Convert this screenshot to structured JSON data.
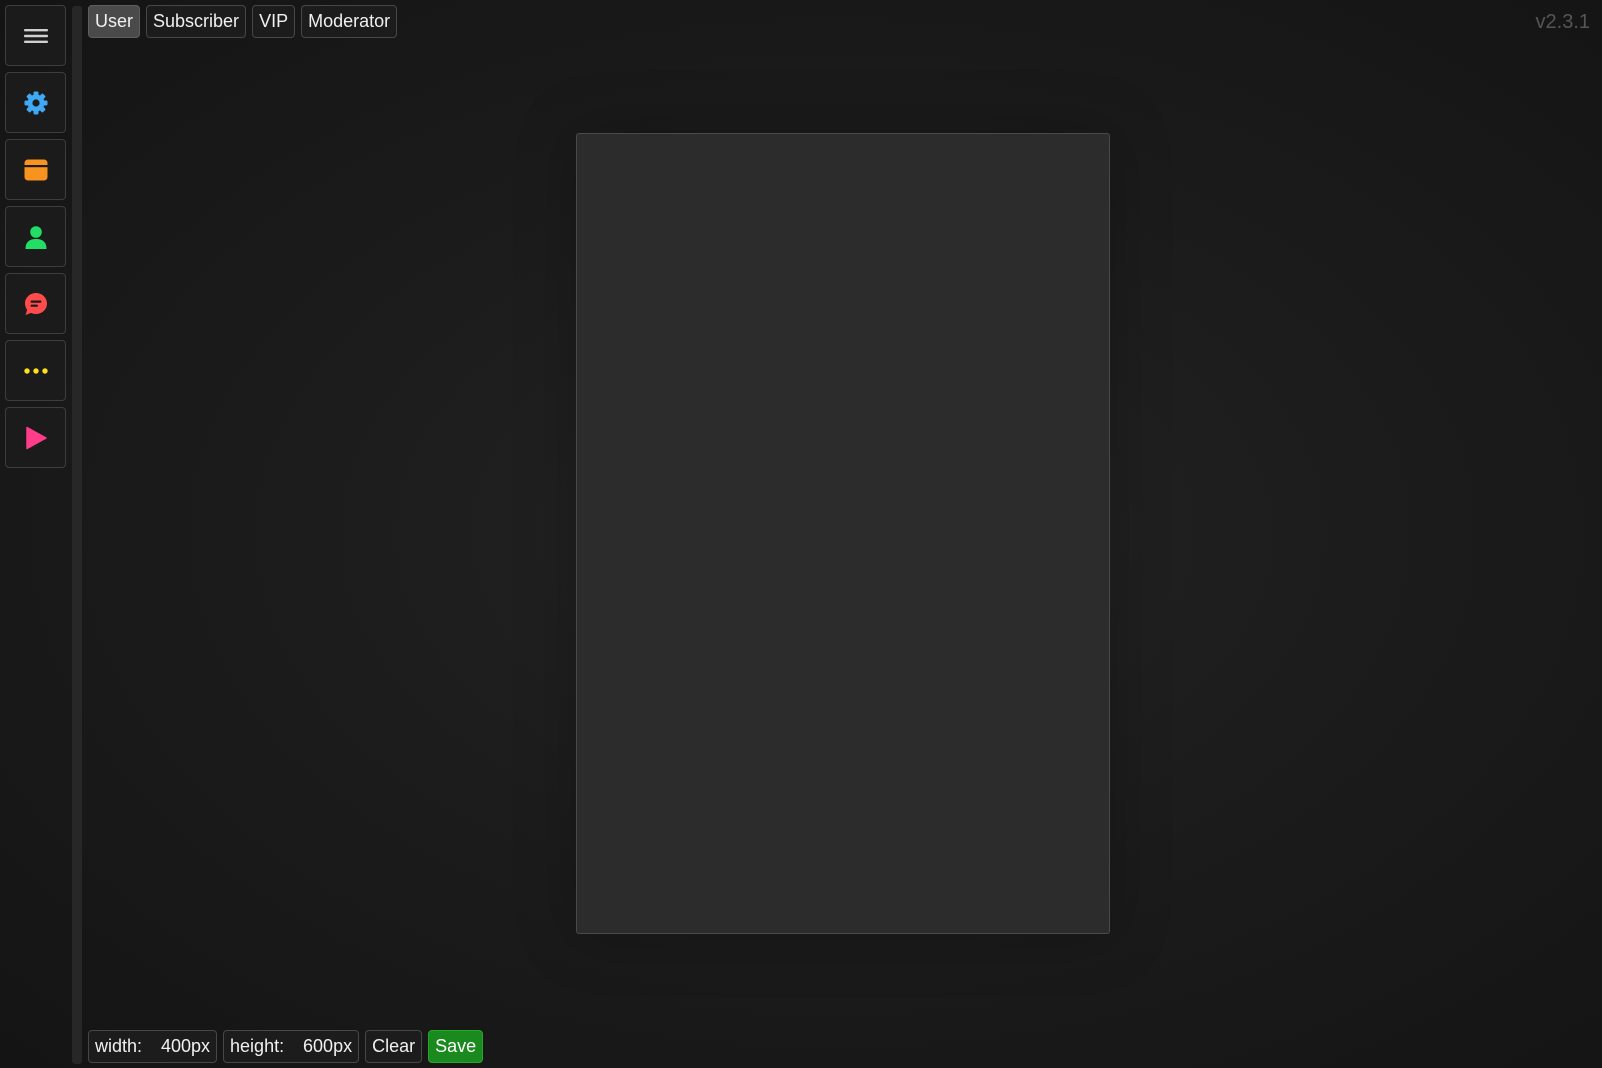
{
  "sidebar": {
    "buttons": [
      {
        "name": "menu",
        "icon": "hamburger-menu-icon",
        "color": "#d0d0d0"
      },
      {
        "name": "settings",
        "icon": "gear-icon",
        "color": "#3fa9f5"
      },
      {
        "name": "window",
        "icon": "window-icon",
        "color": "#f7931e"
      },
      {
        "name": "user",
        "icon": "user-icon",
        "color": "#22dd66"
      },
      {
        "name": "chat",
        "icon": "chat-bubble-icon",
        "color": "#ff4b4b"
      },
      {
        "name": "more",
        "icon": "more-dots-icon",
        "color": "#ffe11a"
      },
      {
        "name": "play",
        "icon": "play-icon",
        "color": "#ff3d8b"
      }
    ]
  },
  "tabs": [
    {
      "label": "User",
      "active": true
    },
    {
      "label": "Subscriber",
      "active": false
    },
    {
      "label": "VIP",
      "active": false
    },
    {
      "label": "Moderator",
      "active": false
    }
  ],
  "version": "v2.3.1",
  "toolbar": {
    "width_label": "width:",
    "width_value": "400px",
    "height_label": "height:",
    "height_value": "600px",
    "clear_label": "Clear",
    "save_label": "Save"
  },
  "colors": {
    "save": "#1a8a1f",
    "background": "#1c1c1c",
    "canvas": "#2c2c2c"
  }
}
